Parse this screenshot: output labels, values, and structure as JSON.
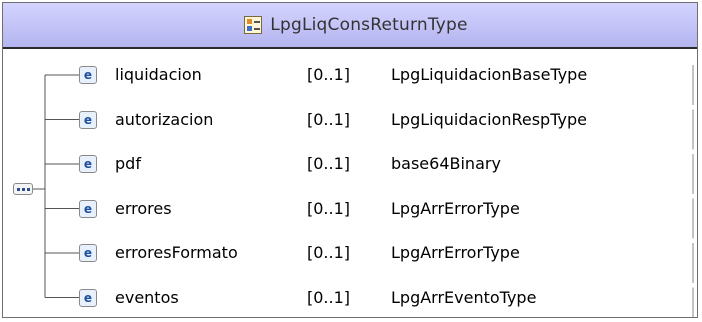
{
  "header": {
    "title": "LpgLiqConsReturnType",
    "icon": "complex-type-icon"
  },
  "compositor": {
    "icon": "sequence-icon"
  },
  "elements": [
    {
      "name": "liquidacion",
      "cardinality": "[0..1]",
      "type": "LpgLiquidacionBaseType"
    },
    {
      "name": "autorizacion",
      "cardinality": "[0..1]",
      "type": "LpgLiquidacionRespType"
    },
    {
      "name": "pdf",
      "cardinality": "[0..1]",
      "type": "base64Binary"
    },
    {
      "name": "errores",
      "cardinality": "[0..1]",
      "type": "LpgArrErrorType"
    },
    {
      "name": "erroresFormato",
      "cardinality": "[0..1]",
      "type": "LpgArrErrorType"
    },
    {
      "name": "eventos",
      "cardinality": "[0..1]",
      "type": "LpgArrEventoType"
    }
  ],
  "element_badge": "e",
  "colors": {
    "header_top": "#d4d4ff",
    "header_bottom": "#b4b4f0",
    "badge_text": "#1f4f9f"
  }
}
